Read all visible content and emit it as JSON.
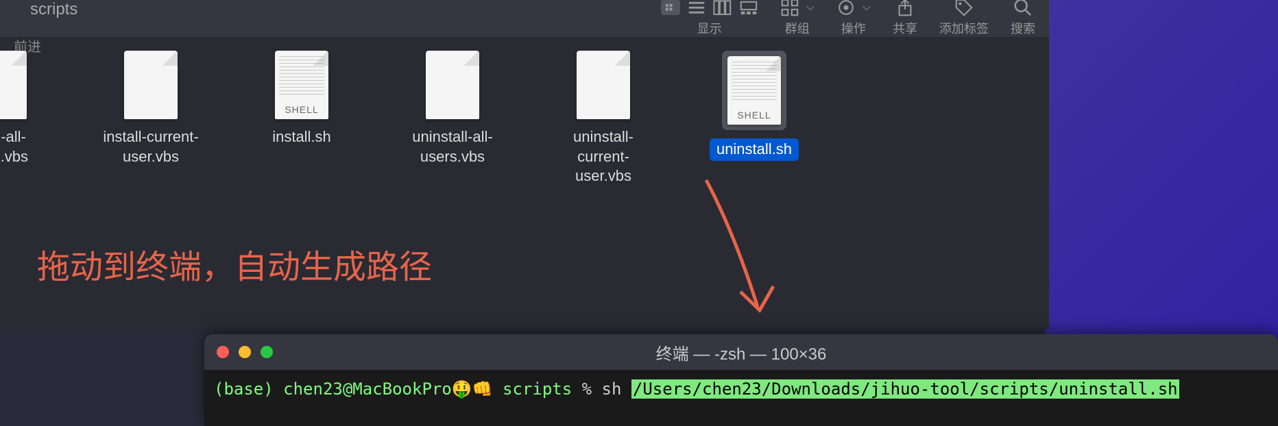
{
  "finder": {
    "title": "scripts",
    "nav_back": "前进",
    "toolbar": {
      "view_label": "显示",
      "group_label": "群组",
      "action_label": "操作",
      "share_label": "共享",
      "tags_label": "添加标签",
      "search_label": "搜索"
    },
    "files": [
      {
        "name": "stall-all-\nsers.vbs",
        "type": "plain"
      },
      {
        "name": "install-current-\nuser.vbs",
        "type": "plain"
      },
      {
        "name": "install.sh",
        "type": "shell"
      },
      {
        "name": "uninstall-all-\nusers.vbs",
        "type": "plain"
      },
      {
        "name": "uninstall-current-\nuser.vbs",
        "type": "plain"
      },
      {
        "name": "uninstall.sh",
        "type": "shell",
        "selected": true
      }
    ]
  },
  "annotation": "拖动到终端，自动生成路径",
  "terminal": {
    "title": "终端 — -zsh — 100×36",
    "env": "(base)",
    "user_host": "chen23@MacBookPro",
    "emoji": "🤑👊",
    "dir": "scripts",
    "prompt_char": "%",
    "command": "sh",
    "path": "/Users/chen23/Downloads/jihuo-tool/scripts/uninstall.sh"
  }
}
